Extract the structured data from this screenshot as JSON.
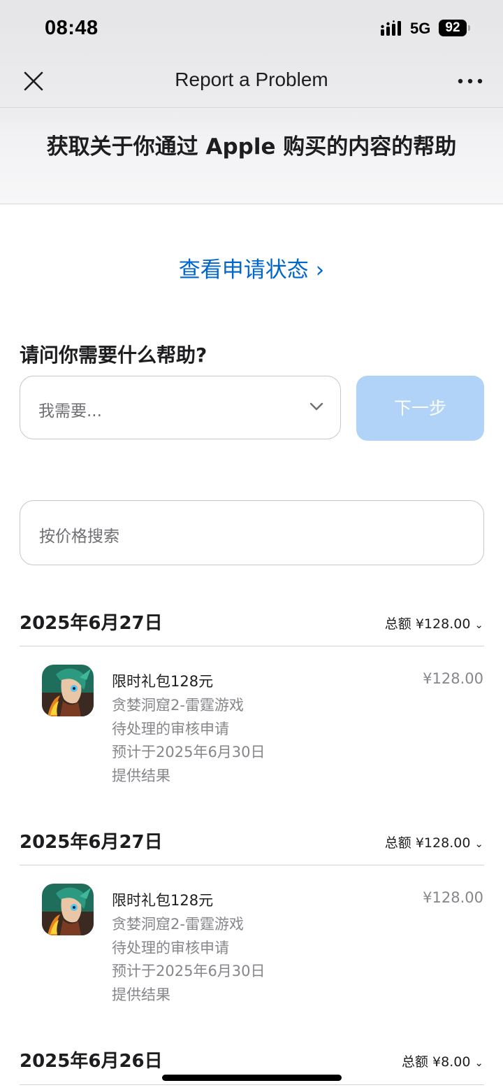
{
  "status_bar": {
    "time": "08:48",
    "network": "5G",
    "battery": "92"
  },
  "nav": {
    "title": "Report a Problem",
    "close_icon": "close-icon",
    "more_icon": "more-icon"
  },
  "hero": {
    "title": "获取关于你通过 Apple 购买的内容的帮助"
  },
  "status_link": {
    "label": "查看申请状态",
    "chevron": "›"
  },
  "help": {
    "heading": "请问你需要什么帮助?",
    "select_value": "我需要...",
    "next_label": "下一步"
  },
  "search": {
    "placeholder": "按价格搜索"
  },
  "colors": {
    "link": "#0066cc",
    "next_button_disabled": "#b0d3f7",
    "secondary_text": "#86868b"
  },
  "purchases": [
    {
      "date": "2025年6月27日",
      "total": "总额 ¥128.00",
      "items": [
        {
          "title": "限时礼包128元",
          "app": "贪婪洞窟2-雷霆游戏",
          "status": "待处理的审核申请",
          "eta_line1": "预计于2025年6月30日",
          "eta_line2": "提供结果",
          "price": "¥128.00"
        }
      ]
    },
    {
      "date": "2025年6月27日",
      "total": "总额 ¥128.00",
      "items": [
        {
          "title": "限时礼包128元",
          "app": "贪婪洞窟2-雷霆游戏",
          "status": "待处理的审核申请",
          "eta_line1": "预计于2025年6月30日",
          "eta_line2": "提供结果",
          "price": "¥128.00"
        }
      ]
    },
    {
      "date": "2025年6月26日",
      "total": "总额 ¥8.00",
      "items": []
    }
  ]
}
